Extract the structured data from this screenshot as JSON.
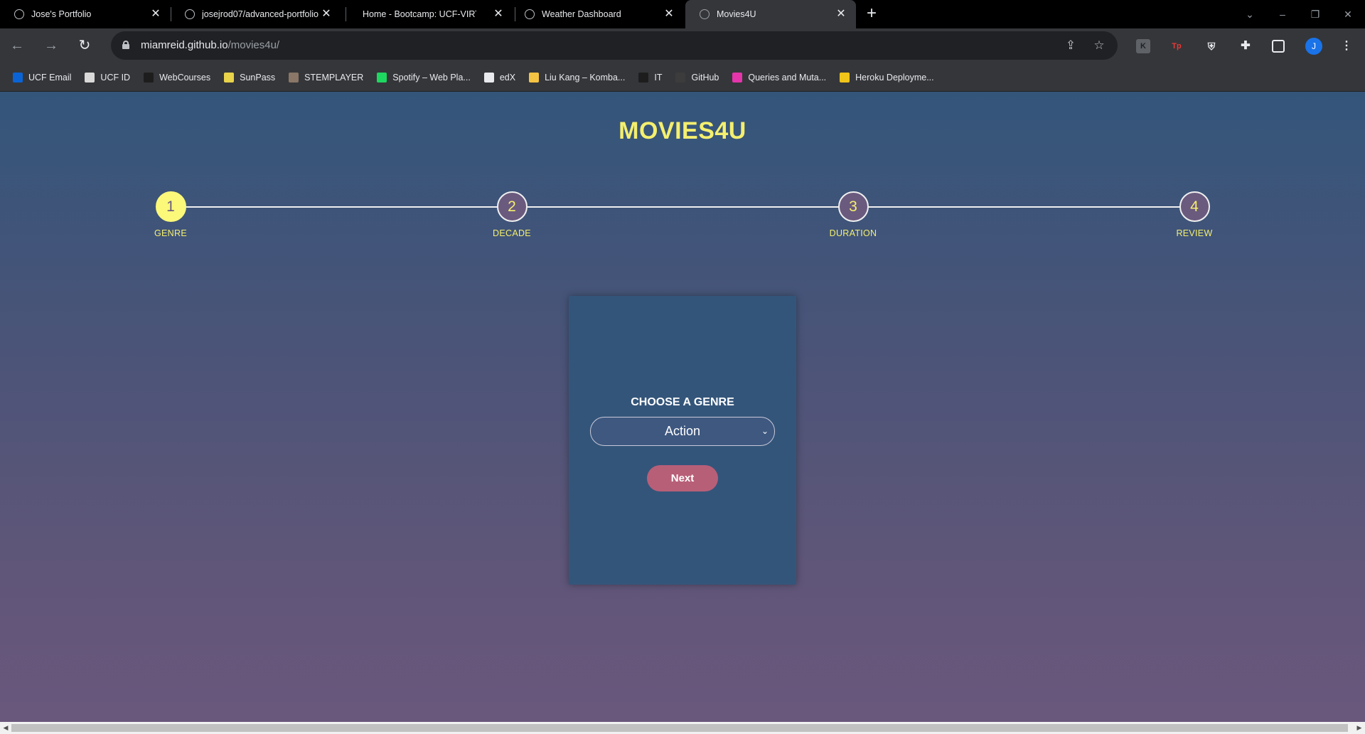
{
  "browser": {
    "tabs": [
      {
        "title": "Jose's Portfolio"
      },
      {
        "title": "josejrod07/advanced-portfolio"
      },
      {
        "title": "Home - Bootcamp: UCF-VIRT-I"
      },
      {
        "title": "Weather Dashboard"
      },
      {
        "title": "Movies4U"
      }
    ],
    "url_host": "miamreid.github.io",
    "url_path": "/movies4u/",
    "profile_initial": "J",
    "bookmarks": [
      {
        "label": "UCF Email",
        "icon": "outlook-icon",
        "color": "#0a64d6"
      },
      {
        "label": "UCF ID",
        "icon": "ucf-id-icon",
        "color": "#d9d9d9"
      },
      {
        "label": "WebCourses",
        "icon": "webcourses-icon",
        "color": "#1d1d1d"
      },
      {
        "label": "SunPass",
        "icon": "sunpass-icon",
        "color": "#e8d34a"
      },
      {
        "label": "STEMPLAYER",
        "icon": "stemplayer-icon",
        "color": "#8a7767"
      },
      {
        "label": "Spotify – Web Pla...",
        "icon": "spotify-icon",
        "color": "#1ed760"
      },
      {
        "label": "edX",
        "icon": "edx-icon",
        "color": "#e8eaed"
      },
      {
        "label": "Liu Kang – Komba...",
        "icon": "liu-kang-icon",
        "color": "#f6c443"
      },
      {
        "label": "IT",
        "icon": "it-icon",
        "color": "#1d1d1d"
      },
      {
        "label": "GitHub",
        "icon": "github-icon",
        "color": "#3c3c3c"
      },
      {
        "label": "Queries and Muta...",
        "icon": "graphql-icon",
        "color": "#e535ab"
      },
      {
        "label": "Heroku Deployme...",
        "icon": "js-icon",
        "color": "#f0c419"
      }
    ]
  },
  "page": {
    "brand": "MOVIES4U",
    "steps": [
      {
        "number": "1",
        "label": "GENRE",
        "active": true
      },
      {
        "number": "2",
        "label": "DECADE",
        "active": false
      },
      {
        "number": "3",
        "label": "DURATION",
        "active": false
      },
      {
        "number": "4",
        "label": "REVIEW",
        "active": false
      }
    ],
    "prompt": "CHOOSE A GENRE",
    "genre_selected": "Action",
    "next_label": "Next"
  },
  "colors": {
    "accent_yellow": "#f4ef6e",
    "card_blue": "#34557a",
    "next_button": "#b85f78"
  }
}
